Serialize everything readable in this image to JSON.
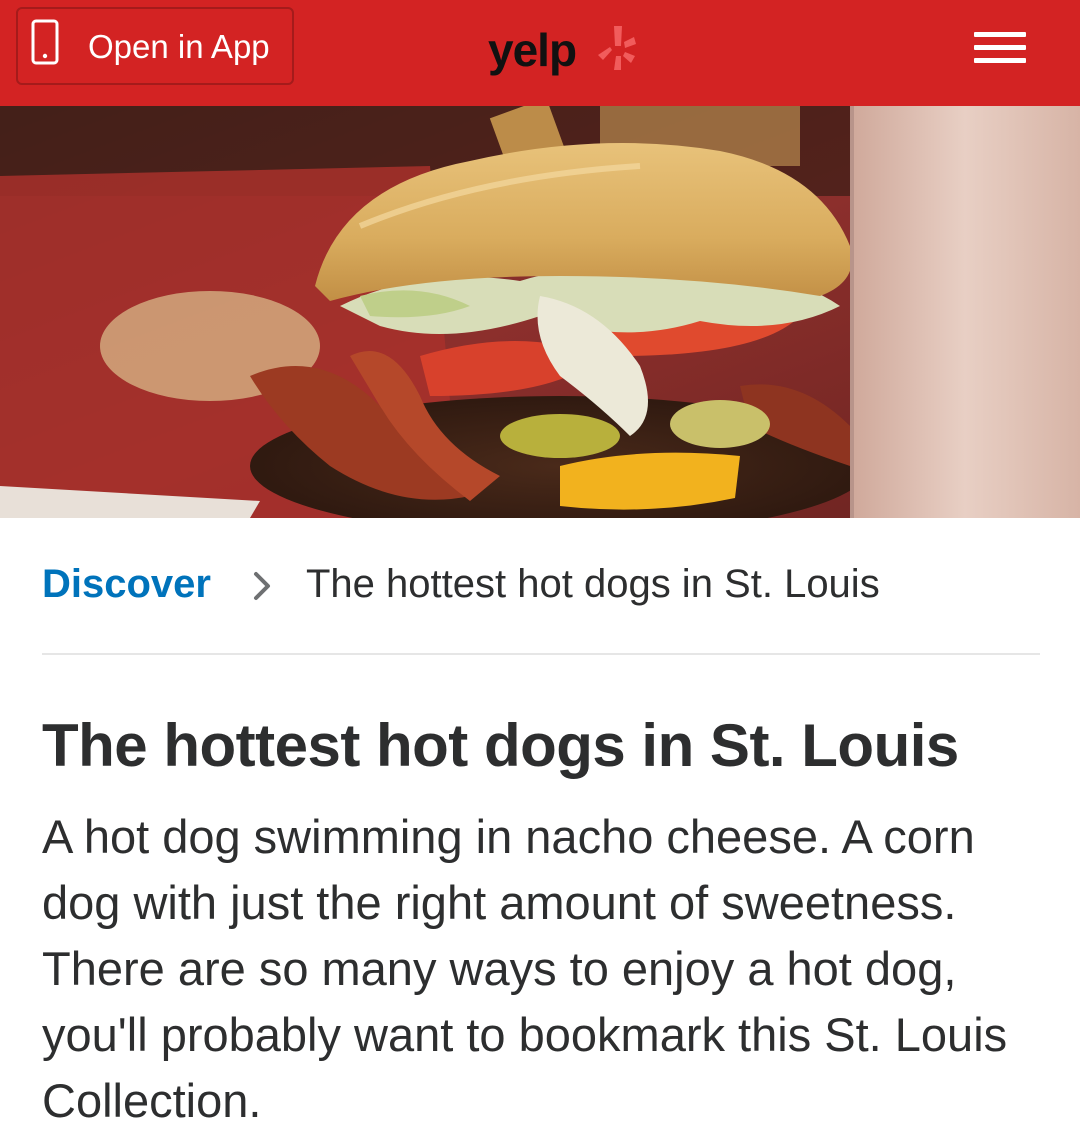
{
  "header": {
    "open_app_label": "Open in App",
    "logo_text": "yelp",
    "brand_color": "#d32323",
    "icons": {
      "phone": "phone-icon",
      "logo_burst": "yelp-burst-icon",
      "menu": "hamburger-menu-icon"
    }
  },
  "hero": {
    "icon": "food-photo"
  },
  "breadcrumb": {
    "link_label": "Discover",
    "separator_icon": "chevron-right-icon",
    "current_label": "The hottest hot dogs in St. Louis",
    "link_color": "#0073bb"
  },
  "main": {
    "title": "The hottest hot dogs in St. Louis",
    "description": "A hot dog swimming in nacho cheese. A corn dog with just the right amount of sweetness. There are so many ways to enjoy a hot dog, you'll probably want to bookmark this St. Louis Collection."
  }
}
